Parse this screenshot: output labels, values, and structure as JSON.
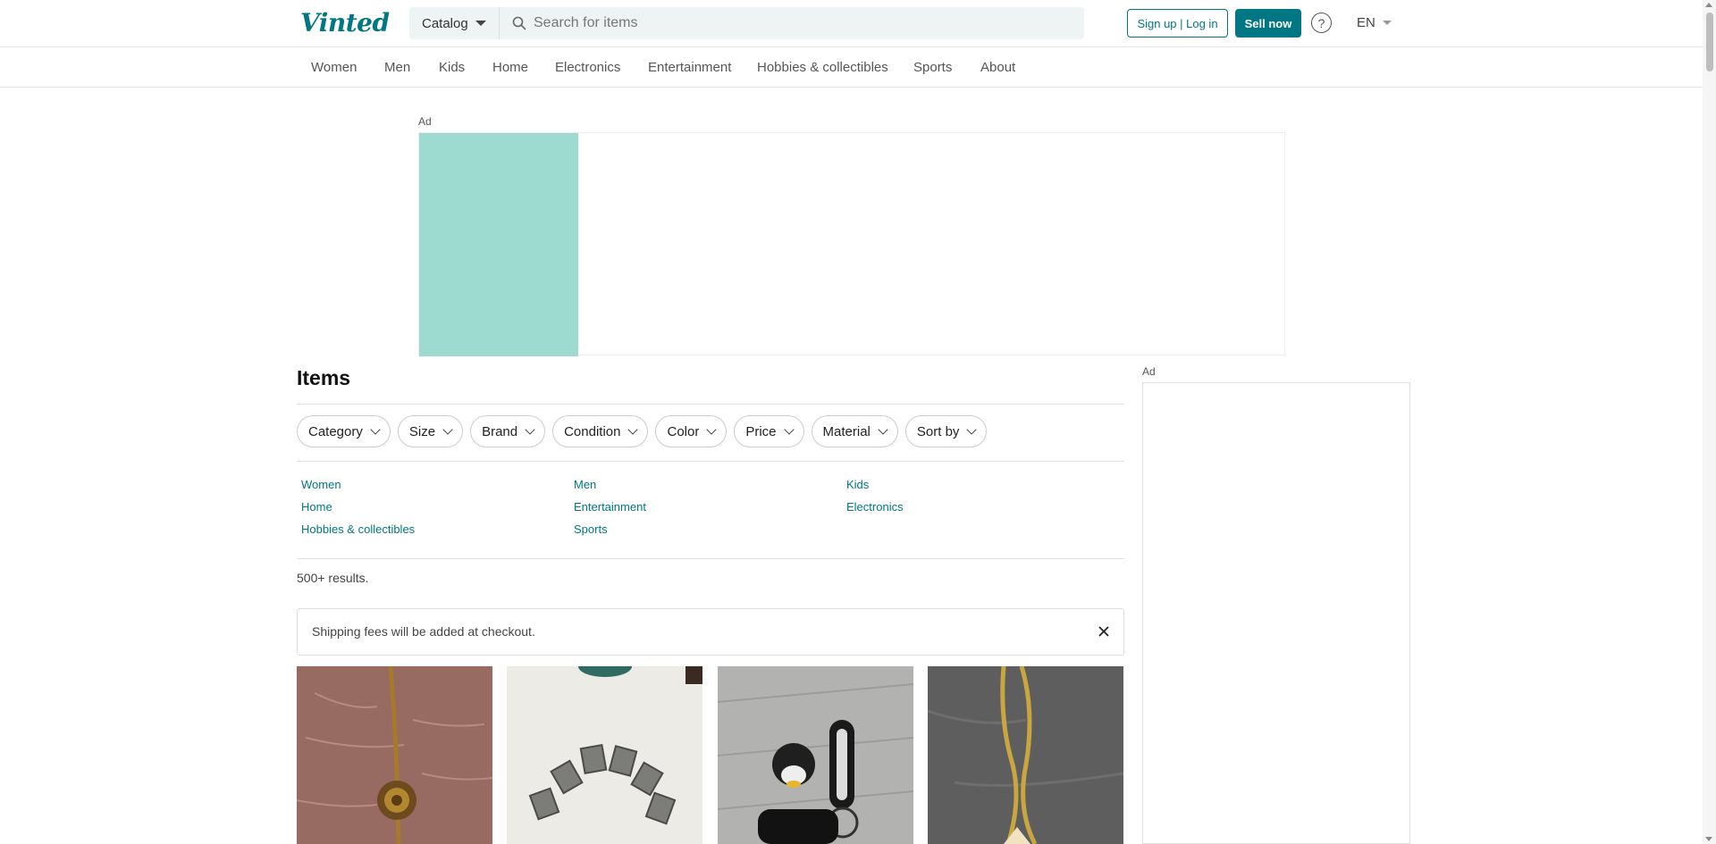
{
  "header": {
    "logo": "Vinted",
    "catalog_label": "Catalog",
    "search_placeholder": "Search for items",
    "signup_label": "Sign up | Log in",
    "sell_label": "Sell now",
    "help_glyph": "?",
    "language": "EN"
  },
  "nav": {
    "items": [
      "Women",
      "Men",
      "Kids",
      "Home",
      "Electronics",
      "Entertainment",
      "Hobbies & collectibles",
      "Sports",
      "About"
    ]
  },
  "ads": {
    "top_label": "Ad",
    "side_label": "Ad"
  },
  "main": {
    "title": "Items",
    "filters": [
      "Category",
      "Size",
      "Brand",
      "Condition",
      "Color",
      "Price",
      "Material",
      "Sort by"
    ],
    "category_links": [
      "Women",
      "Men",
      "Kids",
      "Home",
      "Entertainment",
      "Electronics",
      "Hobbies & collectibles",
      "Sports"
    ],
    "results": "500+ results.",
    "shipping_notice": "Shipping fees will be added at checkout."
  },
  "colors": {
    "brand": "#007782",
    "ad_teal": "#9ddbd1"
  },
  "icons": [
    "search-icon",
    "caret-down-icon",
    "help-icon",
    "chevron-down-icon",
    "close-icon"
  ]
}
